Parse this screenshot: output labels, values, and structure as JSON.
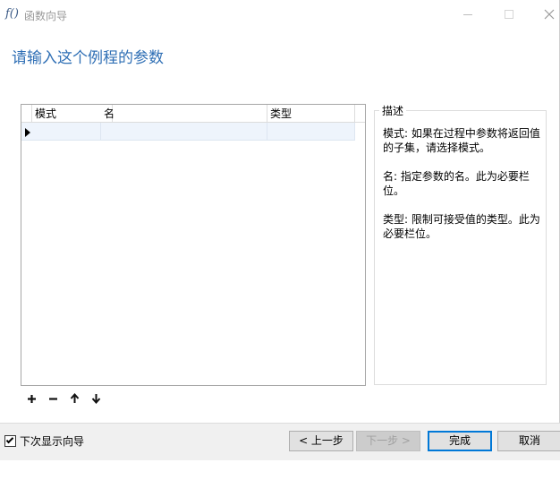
{
  "window": {
    "icon_label": "f()",
    "title": "函数向导"
  },
  "heading": "请输入这个例程的参数",
  "grid": {
    "columns": [
      "模式",
      "名",
      "类型"
    ]
  },
  "description": {
    "legend": "描述",
    "paragraphs": [
      "模式: 如果在过程中参数将返回值的子集，请选择模式。",
      "名: 指定参数的名。此为必要栏位。",
      "类型: 限制可接受值的类型。此为必要栏位。"
    ]
  },
  "toolbar": {
    "add": "+",
    "remove": "−",
    "up": "🡑",
    "down": "🡓"
  },
  "footer": {
    "show_next_label": "下次显示向导",
    "show_next_checked": true,
    "back_label": "< 上一步",
    "next_label": "下一步 >",
    "finish_label": "完成",
    "cancel_label": "取消"
  },
  "colors": {
    "heading": "#2f6fb5",
    "focus_border": "#0078d7",
    "selected_row": "#eef4fc"
  }
}
